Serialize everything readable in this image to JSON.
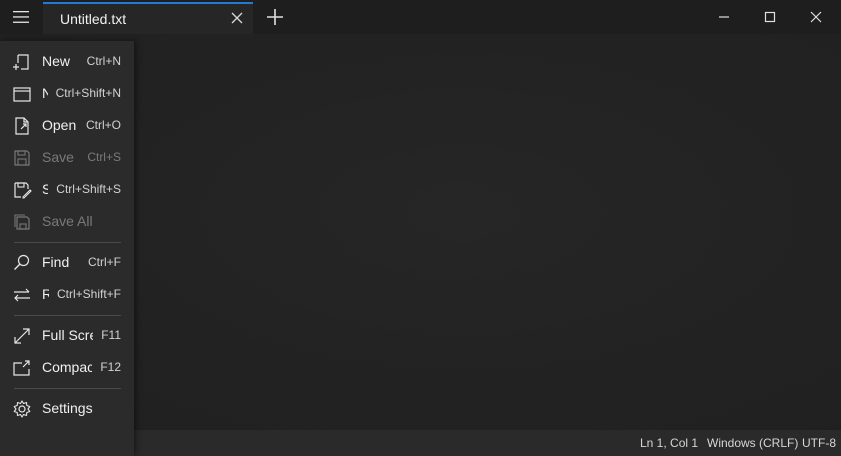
{
  "tab": {
    "title": "Untitled.txt"
  },
  "menu": {
    "items": [
      {
        "label": "New",
        "shortcut": "Ctrl+N",
        "icon": "new-file-icon"
      },
      {
        "label": "New Window",
        "shortcut": "Ctrl+Shift+N",
        "icon": "new-window-icon"
      },
      {
        "label": "Open",
        "shortcut": "Ctrl+O",
        "icon": "open-file-icon"
      },
      {
        "label": "Save",
        "shortcut": "Ctrl+S",
        "icon": "save-icon"
      },
      {
        "label": "Save As",
        "shortcut": "Ctrl+Shift+S",
        "icon": "save-as-icon"
      },
      {
        "label": "Save All",
        "shortcut": "",
        "icon": "save-all-icon"
      },
      {
        "label": "Find",
        "shortcut": "Ctrl+F",
        "icon": "search-icon"
      },
      {
        "label": "Replace",
        "shortcut": "Ctrl+Shift+F",
        "icon": "replace-icon"
      },
      {
        "label": "Full Screen",
        "shortcut": "F11",
        "icon": "fullscreen-icon"
      },
      {
        "label": "Compact Overlay",
        "shortcut": "F12",
        "icon": "compact-overlay-icon"
      },
      {
        "label": "Settings",
        "shortcut": "",
        "icon": "gear-icon"
      }
    ]
  },
  "status": {
    "position": "Ln 1, Col 1",
    "line_ending": "Windows (CRLF)",
    "encoding": "UTF-8"
  },
  "colors": {
    "accent": "#1f7bd6",
    "background": "#202020",
    "menu_background": "#2b2b2b"
  }
}
